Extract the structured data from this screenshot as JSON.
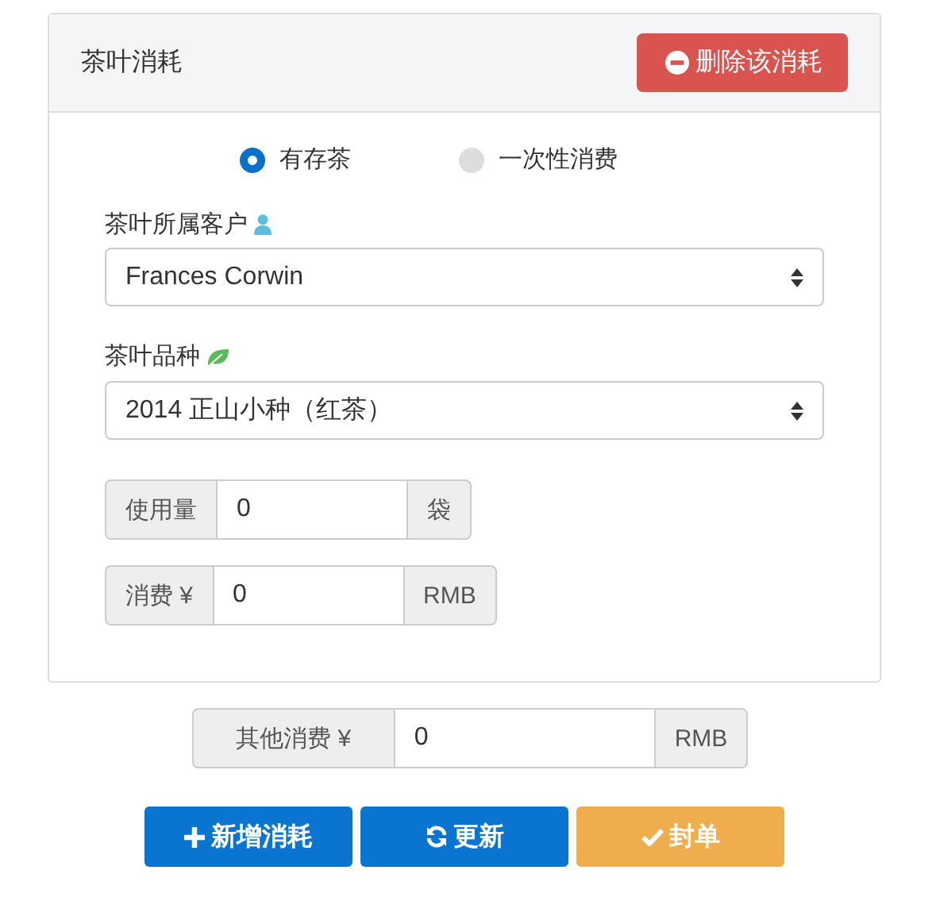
{
  "panel": {
    "title": "茶叶消耗",
    "delete_button": "删除该消耗"
  },
  "radios": [
    {
      "label": "有存茶",
      "selected": true
    },
    {
      "label": "一次性消费",
      "selected": false
    }
  ],
  "customer": {
    "label": "茶叶所属客户",
    "value": "Frances Corwin"
  },
  "variety": {
    "label": "茶叶品种",
    "value": "2014 正山小种（红茶）"
  },
  "groups": [
    {
      "prefix": "使用量",
      "value": "0",
      "suffix": "袋"
    },
    {
      "prefix": "消费 ¥",
      "value": "0",
      "suffix": "RMB"
    }
  ],
  "other": {
    "prefix": "其他消费 ¥",
    "value": "0",
    "suffix": "RMB"
  },
  "buttons": [
    {
      "label": "新增消耗",
      "kind": "add"
    },
    {
      "label": "更新",
      "kind": "refresh"
    },
    {
      "label": "封单",
      "kind": "seal"
    }
  ]
}
